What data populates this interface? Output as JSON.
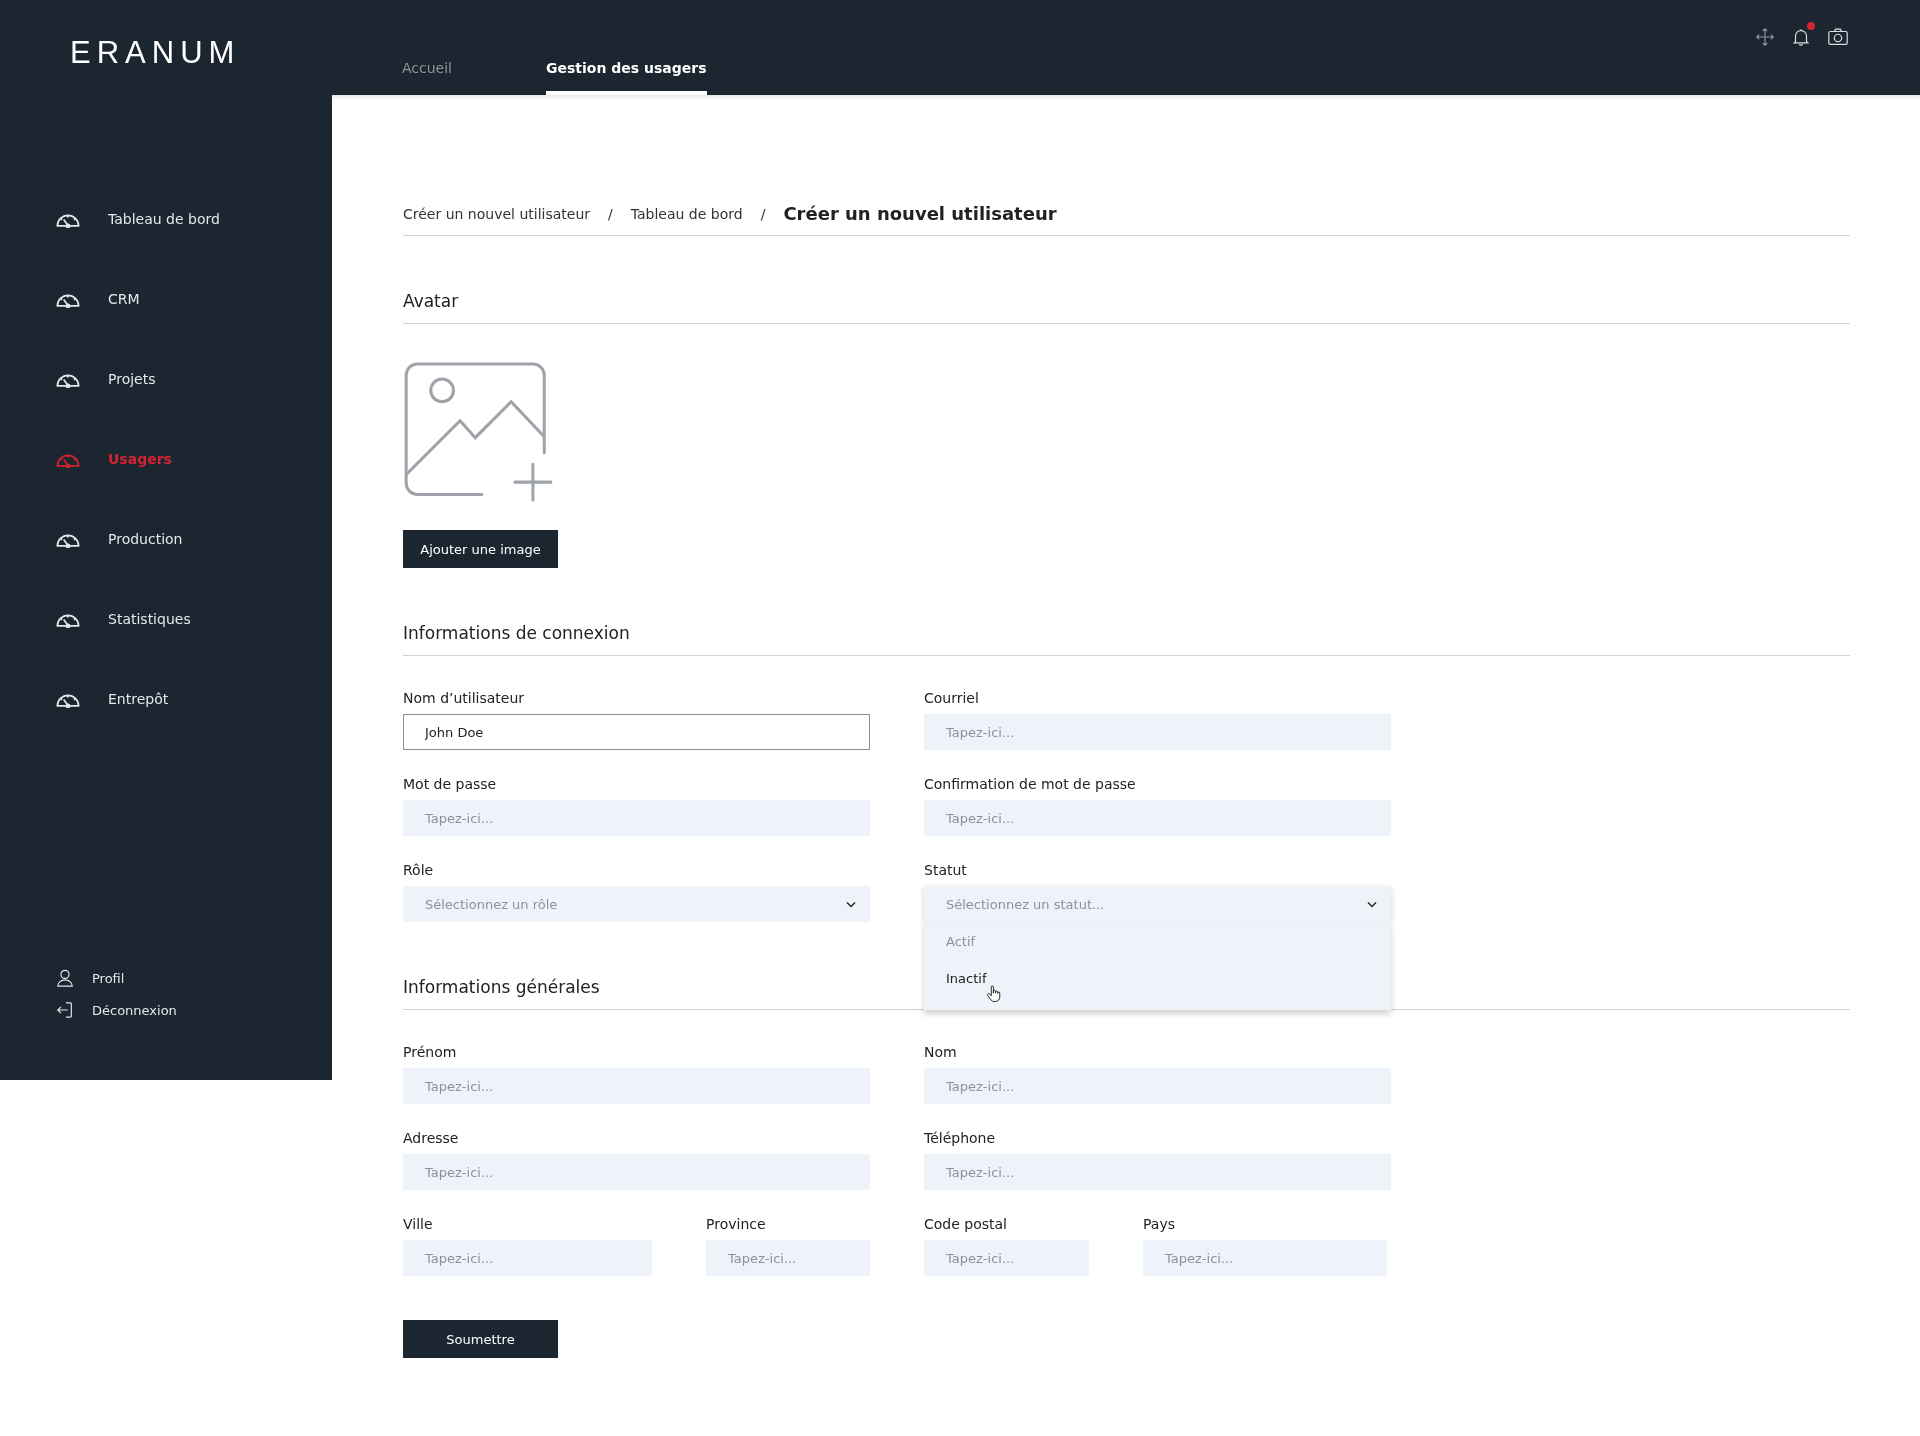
{
  "logo": "ERANUM",
  "top_nav": [
    {
      "label": "Accueil",
      "selected": false
    },
    {
      "label": "Gestion des usagers",
      "selected": true
    }
  ],
  "notifications": {
    "unread": true
  },
  "sidebar": {
    "items": [
      {
        "label": "Tableau de bord",
        "selected": false
      },
      {
        "label": "CRM",
        "selected": false
      },
      {
        "label": "Projets",
        "selected": false
      },
      {
        "label": "Usagers",
        "selected": true
      },
      {
        "label": "Production",
        "selected": false
      },
      {
        "label": "Statistiques",
        "selected": false
      },
      {
        "label": "Entrepôt",
        "selected": false
      }
    ],
    "footer_items": [
      {
        "kind": "profile",
        "label": "Profil"
      },
      {
        "kind": "logout",
        "label": "Déconnexion"
      }
    ]
  },
  "breadcrumb": [
    {
      "kind": "link",
      "label": "Créer un nouvel utilisateur"
    },
    {
      "kind": "separator",
      "label": "/"
    },
    {
      "kind": "link",
      "label": "Tableau de bord"
    },
    {
      "kind": "separator",
      "label": "/"
    },
    {
      "kind": "current",
      "label": "Créer un nouvel utilisateur"
    }
  ],
  "sections": [
    {
      "kind": "avatar",
      "title": "Avatar",
      "button": "Ajouter une image"
    },
    {
      "kind": "form",
      "title": "Informations de connexion",
      "rows": [
        [
          {
            "kind": "text",
            "label": "Nom d’utilisateur",
            "value": "John Doe",
            "focused": true
          },
          {
            "kind": "text",
            "label": "Courriel",
            "placeholder": "Tapez-ici...",
            "focused": false
          }
        ],
        [
          {
            "kind": "text",
            "label": "Mot de passe",
            "placeholder": "Tapez-ici...",
            "focused": false
          },
          {
            "kind": "text",
            "label": "Confirmation de mot de passe",
            "placeholder": "Tapez-ici...",
            "focused": false
          }
        ],
        [
          {
            "kind": "select",
            "label": "Rôle",
            "placeholder": "Sélectionnez un rôle",
            "open": false
          },
          {
            "kind": "select",
            "label": "Statut",
            "placeholder": "Sélectionnez un statut...",
            "open": true,
            "options": [
              {
                "label": "Actif",
                "highlighted": false
              },
              {
                "label": "Inactif",
                "highlighted": true
              }
            ]
          }
        ]
      ]
    },
    {
      "kind": "form",
      "title": "Informations générales",
      "rows": [
        [
          {
            "kind": "text",
            "label": "Prénom",
            "placeholder": "Tapez-ici...",
            "focused": false
          },
          {
            "kind": "text",
            "label": "Nom",
            "placeholder": "Tapez-ici...",
            "focused": false
          }
        ],
        [
          {
            "kind": "text",
            "label": "Adresse",
            "placeholder": "Tapez-ici...",
            "focused": false
          },
          {
            "kind": "text",
            "label": "Téléphone",
            "placeholder": "Tapez-ici...",
            "focused": false
          }
        ],
        [
          {
            "kind": "text",
            "label": "Ville",
            "placeholder": "Tapez-ici...",
            "focused": false
          },
          {
            "kind": "text",
            "label": "Province",
            "placeholder": "Tapez-ici...",
            "focused": false
          },
          {
            "kind": "text",
            "label": "Code postal",
            "placeholder": "Tapez-ici...",
            "focused": false
          },
          {
            "kind": "text",
            "label": "Pays",
            "placeholder": "Tapez-ici...",
            "focused": false
          }
        ]
      ]
    }
  ],
  "submit": "Soumettre"
}
